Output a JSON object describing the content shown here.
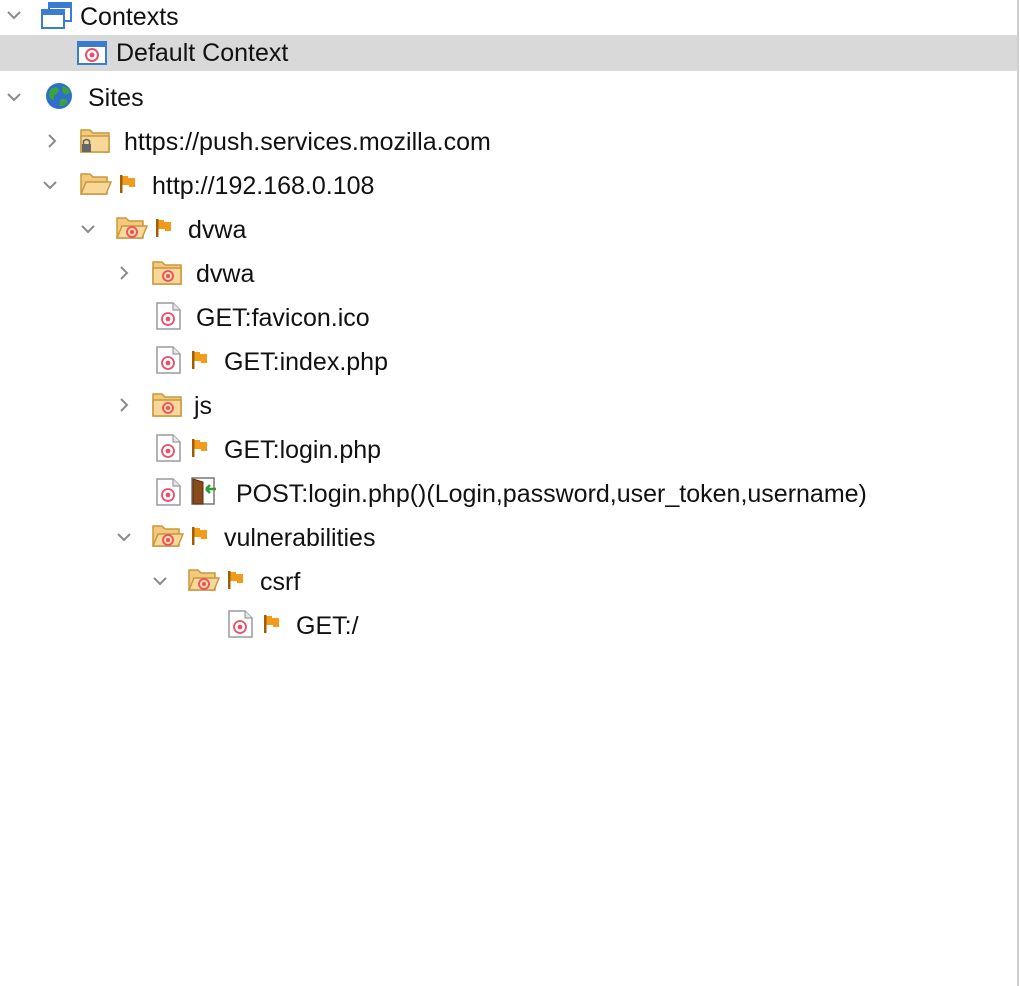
{
  "tree": {
    "contexts": {
      "label": "Contexts",
      "expanded": true,
      "icon": "contexts-windows-icon",
      "children": [
        {
          "label": "Default Context",
          "selected": true,
          "icon": "context-target-icon"
        }
      ]
    },
    "sites": {
      "label": "Sites",
      "expanded": true,
      "icon": "globe-icon",
      "children": [
        {
          "label": "https://push.services.mozilla.com",
          "icon": "locked-folder-icon",
          "expanded": false
        },
        {
          "label": "http://192.168.0.108",
          "icon": "open-folder-icon",
          "flag": true,
          "expanded": true
        }
      ]
    },
    "host_children": {
      "dvwa_root": {
        "label": "dvwa",
        "flag": true,
        "expanded": true
      },
      "dvwa_sub": {
        "label": "dvwa",
        "expanded": false
      },
      "favicon": {
        "label": "GET:favicon.ico"
      },
      "index": {
        "label": "GET:index.php",
        "flag": true
      },
      "js": {
        "label": "js",
        "expanded": false
      },
      "login_get": {
        "label": "GET:login.php",
        "flag": true
      },
      "login_post": {
        "label": "POST:login.php()(Login,password,user_token,username)",
        "icon": "form-door-icon"
      },
      "vulnerabilities": {
        "label": "vulnerabilities",
        "flag": true,
        "expanded": true
      },
      "csrf": {
        "label": "csrf",
        "flag": true,
        "expanded": true
      },
      "csrf_get": {
        "label": "GET:/",
        "flag": true
      }
    }
  },
  "colors": {
    "selection": "#d9d9d9",
    "chevron": "#8a8a8a",
    "folder": "#f3c97a",
    "target": "#e8506a",
    "flag": "#f29a1a"
  }
}
